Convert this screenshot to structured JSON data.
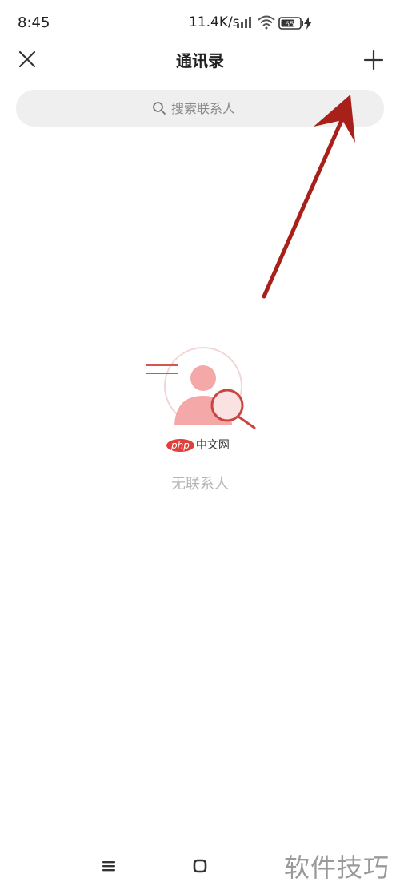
{
  "status_bar": {
    "time": "8:45",
    "network_speed": "11.4K/s",
    "battery_level": "65"
  },
  "header": {
    "title": "通讯录"
  },
  "search": {
    "placeholder": "搜索联系人"
  },
  "empty_state": {
    "text": "无联系人"
  },
  "watermark": {
    "logo_php": "php",
    "logo_cn": "中文网",
    "corner": "软件技巧"
  },
  "colors": {
    "accent_red": "#e0403a",
    "arrow_red": "#a8201a",
    "search_bg": "#efefef",
    "empty_text": "#b5b5b5"
  }
}
